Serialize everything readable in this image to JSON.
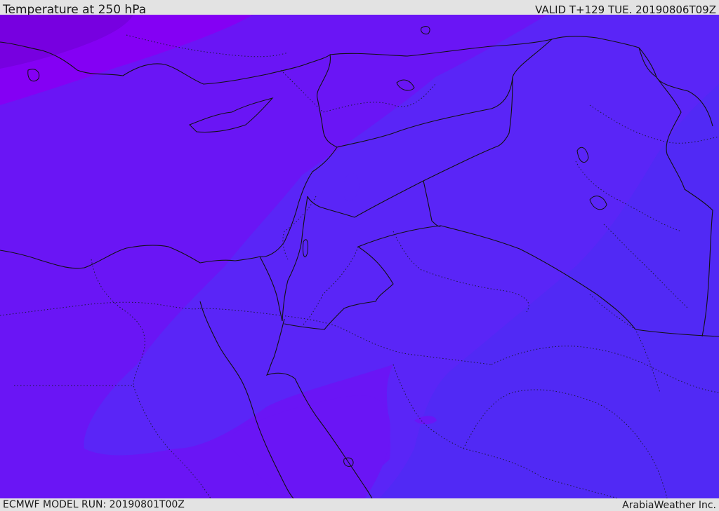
{
  "header": {
    "title": "Temperature at 250 hPa",
    "valid": "VALID T+129 TUE. 20190806T09Z"
  },
  "footer": {
    "model_run": "ECMWF MODEL RUN: 20190801T00Z",
    "credit": "ArabiaWeather Inc."
  },
  "map": {
    "field": "temperature",
    "level": "250 hPa",
    "colors": {
      "coldest": "#7700e0",
      "cold": "#8400f4",
      "mid": "#6a15f5",
      "warm": "#5a25f7",
      "warmest": "#5129f5",
      "coastline": "#111111"
    },
    "icons": {
      "coastline": "coastline-lines",
      "borders": "country-border-lines",
      "admin": "admin-border-dotted-lines"
    }
  }
}
